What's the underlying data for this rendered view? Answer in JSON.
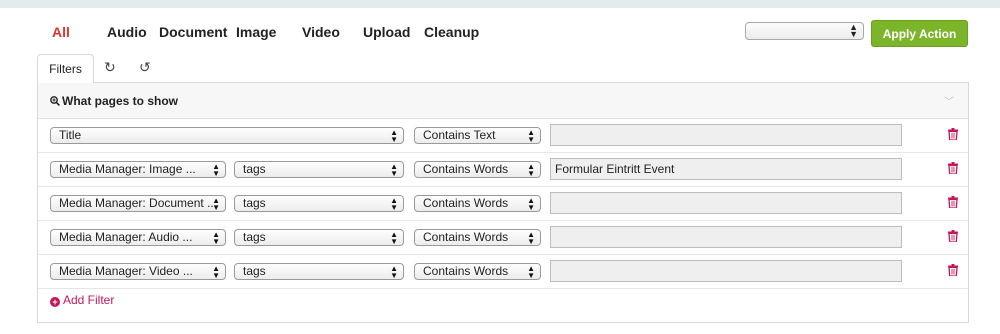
{
  "nav": {
    "items": [
      {
        "label": "All",
        "active": true
      },
      {
        "label": "Audio"
      },
      {
        "label": "Document"
      },
      {
        "label": "Image"
      },
      {
        "label": "Video"
      },
      {
        "label": "Upload"
      },
      {
        "label": "Cleanup"
      }
    ]
  },
  "actions": {
    "select_value": "",
    "apply_label": "Apply Action"
  },
  "tabs": {
    "filters_label": "Filters",
    "refresh_icon": "refresh-icon",
    "reset_icon": "undo-icon"
  },
  "panel": {
    "title": "What pages to show",
    "title_icon": "search-plus-icon",
    "rows": [
      {
        "field": "Title",
        "attribute": null,
        "operator": "Contains Text",
        "value": ""
      },
      {
        "field": "Media Manager: Image ...",
        "attribute": "tags",
        "operator": "Contains Words",
        "value": "Formular Eintritt Event"
      },
      {
        "field": "Media Manager: Document ...",
        "attribute": "tags",
        "operator": "Contains Words",
        "value": ""
      },
      {
        "field": "Media Manager: Audio ...",
        "attribute": "tags",
        "operator": "Contains Words",
        "value": ""
      },
      {
        "field": "Media Manager: Video ...",
        "attribute": "tags",
        "operator": "Contains Words",
        "value": ""
      }
    ],
    "add_filter_label": "Add Filter"
  },
  "colors": {
    "active_nav": "#d9362b",
    "apply_button": "#7cb52a",
    "delete_icon": "#c2185b",
    "add_filter": "#c2185b"
  }
}
